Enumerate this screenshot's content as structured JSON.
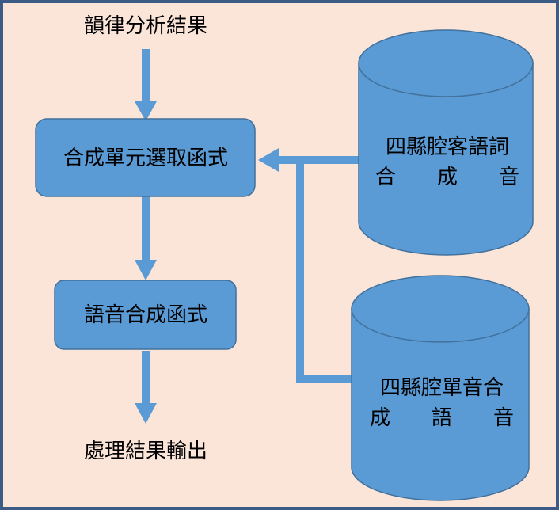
{
  "diagram": {
    "input_label": "韻律分析結果",
    "output_label": "處理結果輸出",
    "process_select": "合成單元選取函式",
    "process_synth": "語音合成函式",
    "db_top_line1": "四縣腔客語詞",
    "db_top_line2": "合　　成　　音",
    "db_bottom_line1": "四縣腔單音合",
    "db_bottom_line2": "成　　語　　音"
  },
  "colors": {
    "background": "#fbe5d9",
    "frame": "#3b5a86",
    "node_fill": "#5b9bd5",
    "node_stroke": "#41719c",
    "text": "#000000"
  }
}
